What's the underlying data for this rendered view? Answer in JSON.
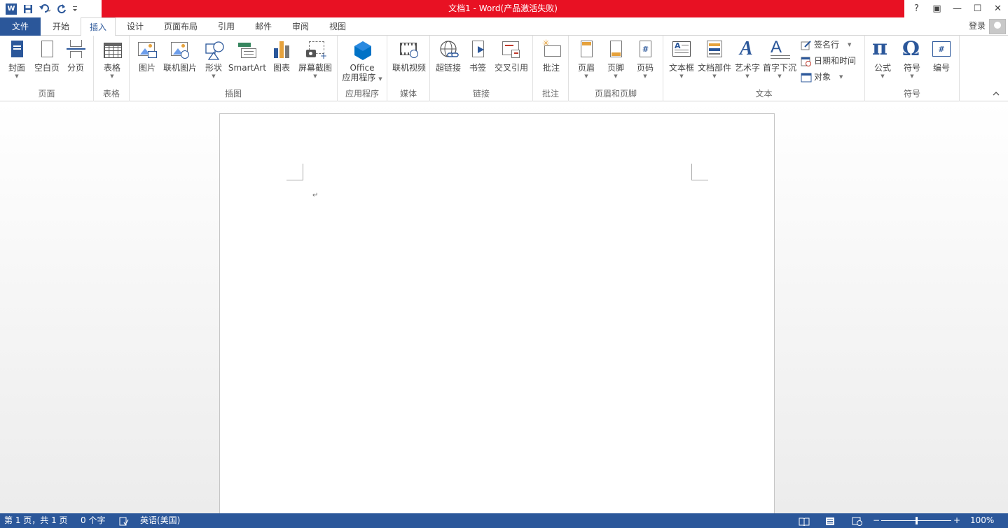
{
  "titlebar": {
    "title": "文档1 -  Word(产品激活失败)",
    "logo_letter": "W",
    "help": "?",
    "restore_ribbon": "▣",
    "minimize": "—",
    "maximize": "☐",
    "close": "✕",
    "accent_color": "#e81123"
  },
  "tabs": [
    "文件",
    "开始",
    "插入",
    "设计",
    "页面布局",
    "引用",
    "邮件",
    "审阅",
    "视图"
  ],
  "account": {
    "login": "登录"
  },
  "ribbon": {
    "page": {
      "label": "页面",
      "cover": "封面",
      "blank": "空白页",
      "break": "分页"
    },
    "table": {
      "label": "表格",
      "table": "表格"
    },
    "illustrations": {
      "label": "插图",
      "picture": "图片",
      "online_picture": "联机图片",
      "shapes": "形状",
      "smartart": "SmartArt",
      "chart": "图表",
      "screenshot": "屏幕截图"
    },
    "apps": {
      "label": "应用程序",
      "office_line1": "Office",
      "office_line2": "应用程序"
    },
    "media": {
      "label": "媒体",
      "online_video": "联机视频"
    },
    "links": {
      "label": "链接",
      "hyperlink": "超链接",
      "bookmark": "书签",
      "cross_ref": "交叉引用"
    },
    "comments": {
      "label": "批注",
      "comment": "批注"
    },
    "header_footer": {
      "label": "页眉和页脚",
      "header": "页眉",
      "footer": "页脚",
      "page_number": "页码"
    },
    "text": {
      "label": "文本",
      "textbox": "文本框",
      "quick_parts": "文档部件",
      "wordart": "艺术字",
      "dropcap": "首字下沉",
      "signature": "签名行",
      "datetime": "日期和时间",
      "object": "对象"
    },
    "symbols": {
      "label": "符号",
      "equation": "公式",
      "symbol": "符号",
      "numbering": "编号"
    }
  },
  "document": {
    "paragraph_mark": "↵"
  },
  "status": {
    "page": "第 1 页，共 1 页",
    "words": "0 个字",
    "language": "英语(美国)",
    "zoom_minus": "−",
    "zoom_plus": "+",
    "zoom": "100%",
    "zoom_fraction": 0.5
  },
  "colors": {
    "brand": "#2b579a"
  }
}
